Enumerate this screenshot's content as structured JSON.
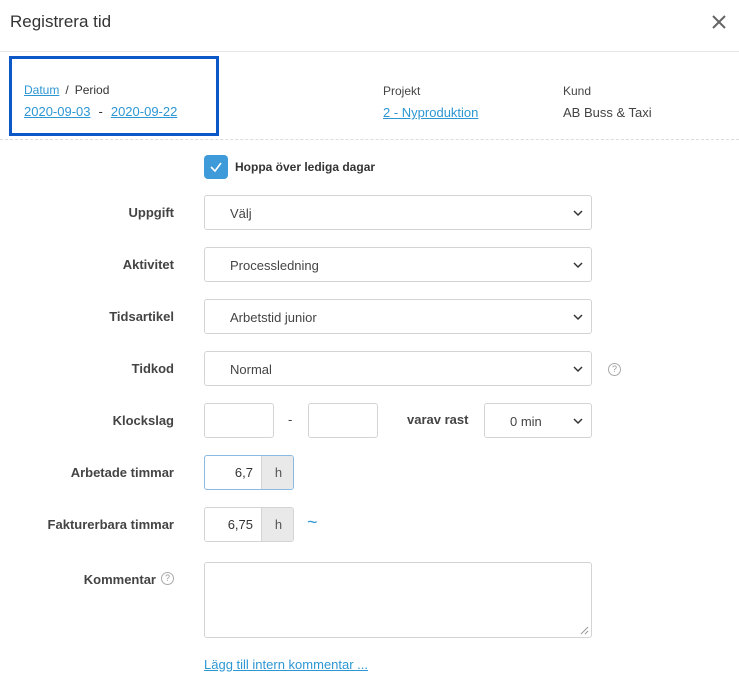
{
  "dialog": {
    "title": "Registrera tid",
    "close_icon": "close-icon"
  },
  "period": {
    "mode_date": "Datum",
    "mode_separator": "/",
    "mode_period": "Period",
    "from": "2020-09-03",
    "dash": "-",
    "to": "2020-09-22"
  },
  "project": {
    "label": "Projekt",
    "value": "2 - Nyproduktion"
  },
  "customer": {
    "label": "Kund",
    "value": "AB Buss & Taxi"
  },
  "skip_free_days": {
    "label": "Hoppa över lediga dagar",
    "checked": true
  },
  "fields": {
    "uppgift": {
      "label": "Uppgift",
      "value": "Välj"
    },
    "aktivitet": {
      "label": "Aktivitet",
      "value": "Processledning"
    },
    "tidsartikel": {
      "label": "Tidsartikel",
      "value": "Arbetstid junior"
    },
    "tidkod": {
      "label": "Tidkod",
      "value": "Normal",
      "help": "?"
    },
    "klockslag": {
      "label": "Klockslag",
      "from": "",
      "to": "",
      "dash": "-",
      "break_label": "varav rast",
      "break_value": "0 min"
    },
    "arbetade": {
      "label": "Arbetade timmar",
      "value": "6,7",
      "unit": "h"
    },
    "fakturerbara": {
      "label": "Fakturerbara timmar",
      "value": "6,75",
      "unit": "h",
      "sync_icon": "~"
    },
    "kommentar": {
      "label": "Kommentar",
      "help": "?",
      "value": ""
    }
  },
  "add_internal_comment": "Lägg till intern kommentar ...",
  "colors": {
    "accent": "#2d97d3",
    "checkbox": "#3e9ad9",
    "highlight_box": "#0d57c6"
  }
}
